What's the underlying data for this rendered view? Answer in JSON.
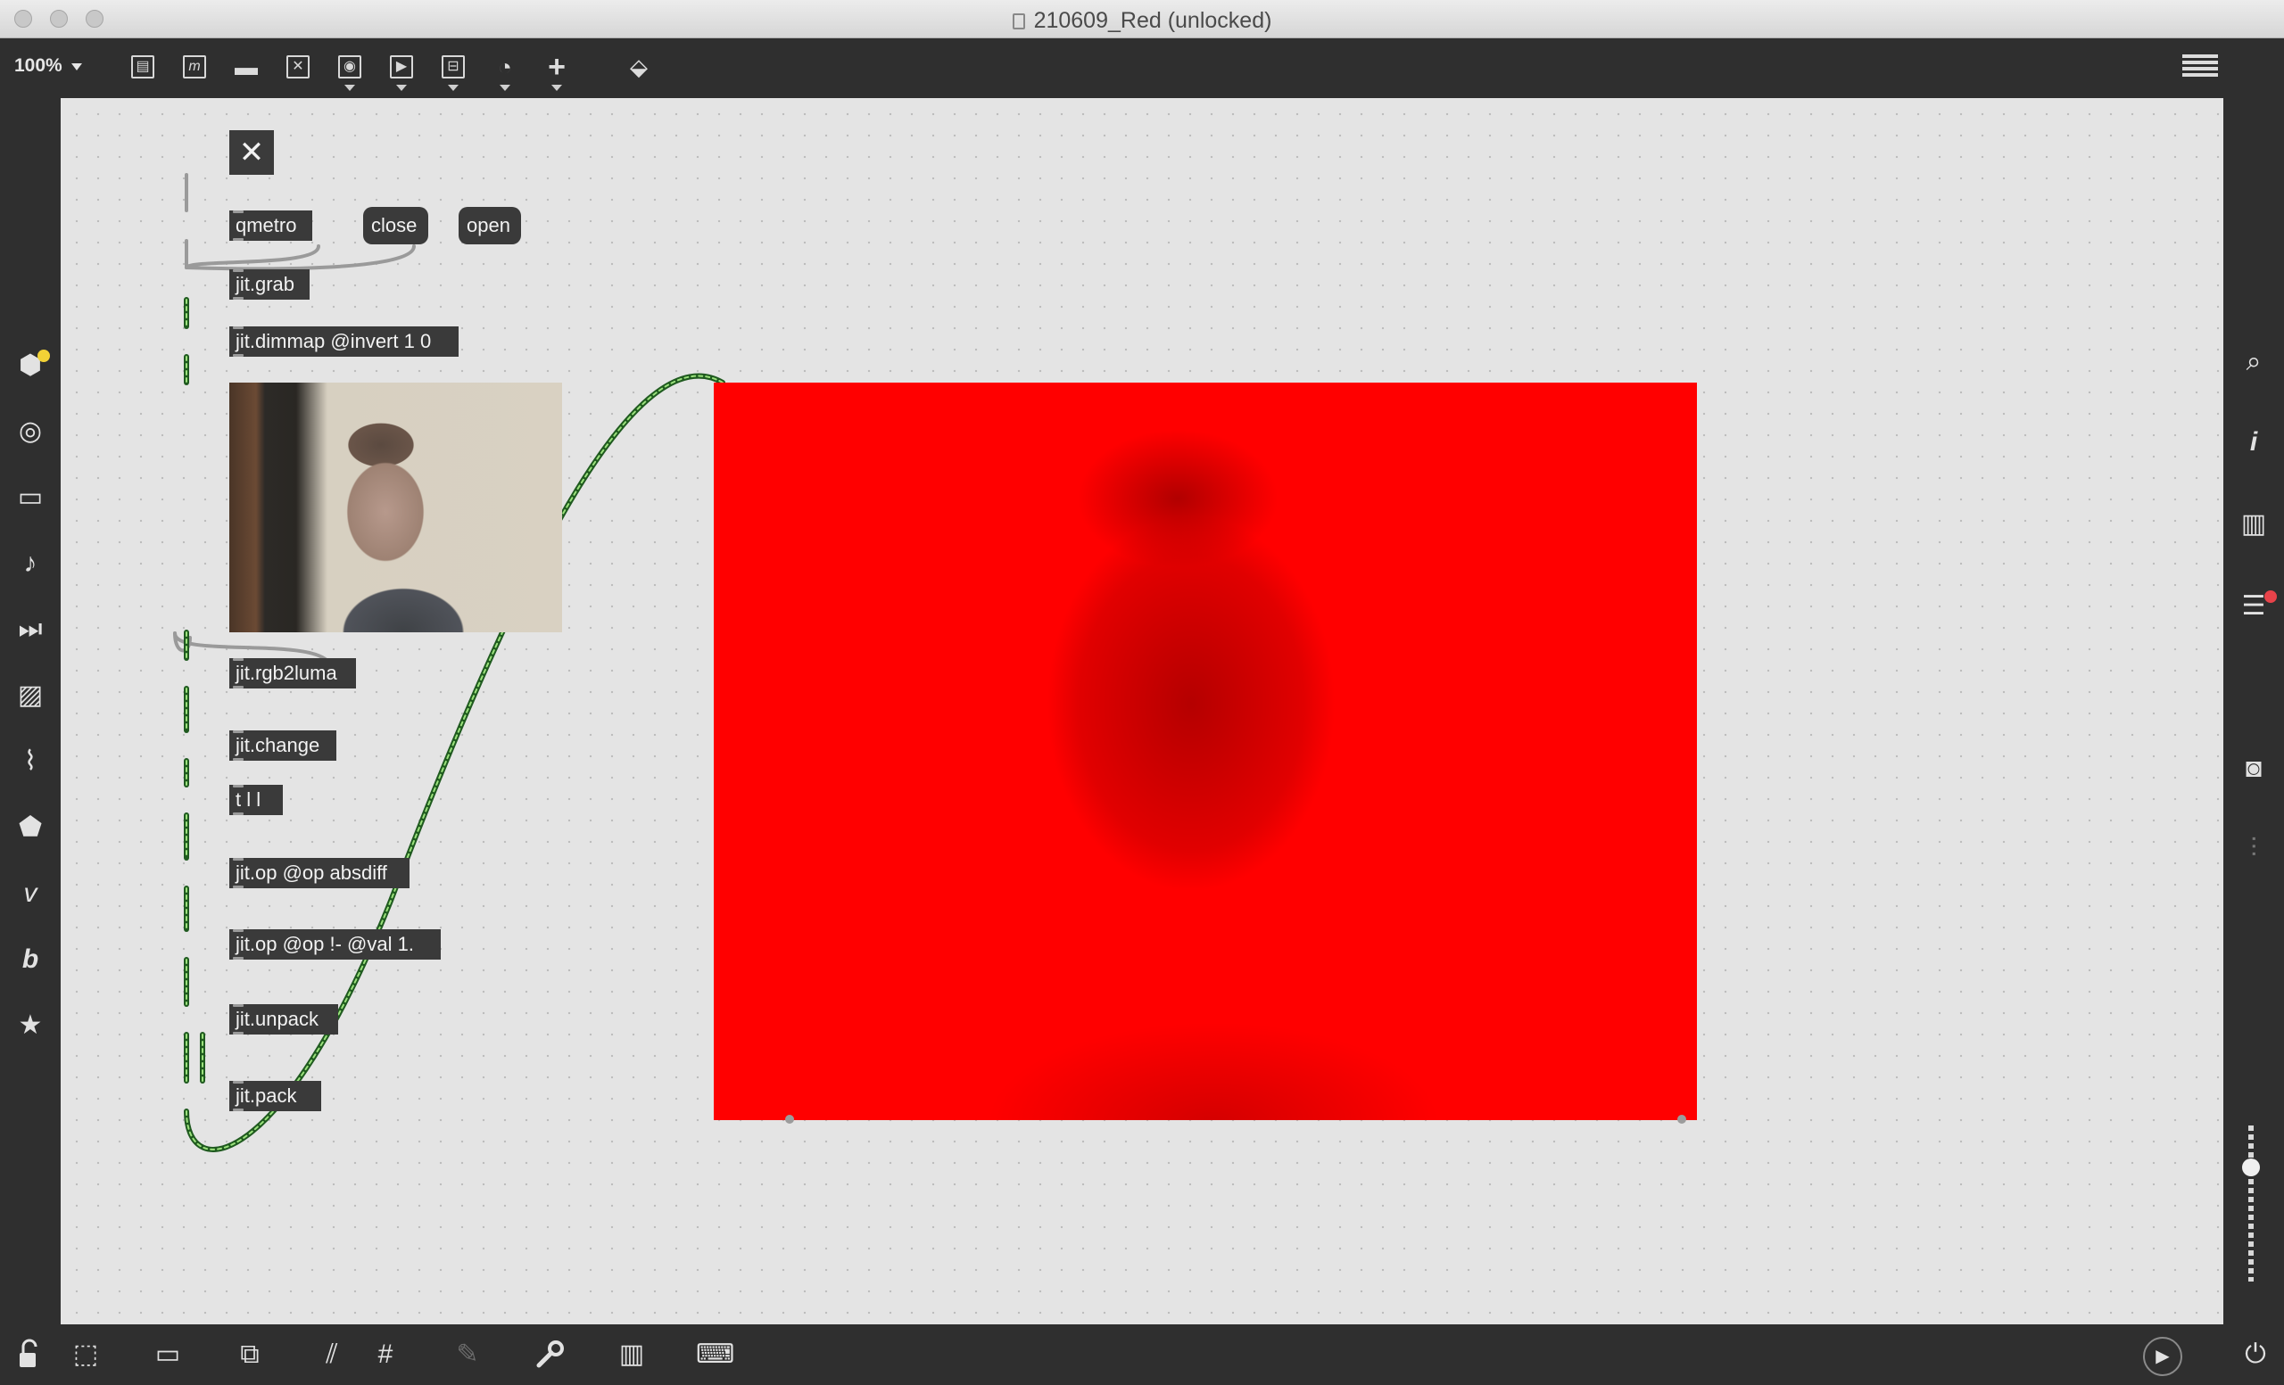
{
  "window": {
    "title": "210609_Red (unlocked)"
  },
  "toolbar": {
    "zoom": "100%",
    "tools": [
      {
        "name": "object-icon",
        "glyph": "▤"
      },
      {
        "name": "message-icon",
        "glyph": "m"
      },
      {
        "name": "comment-icon",
        "glyph": "▬"
      },
      {
        "name": "bang-icon",
        "glyph": "✕"
      },
      {
        "name": "toggle-icon",
        "glyph": "◉"
      },
      {
        "name": "number-icon",
        "glyph": "▶"
      },
      {
        "name": "slider-icon",
        "glyph": "⊟"
      },
      {
        "name": "dial-icon",
        "glyph": "◔"
      },
      {
        "name": "add-icon",
        "glyph": "+"
      },
      {
        "name": "paint-bucket-icon",
        "glyph": "⬙"
      }
    ]
  },
  "left_sidebar": [
    {
      "name": "packages-icon",
      "glyph": "⬢"
    },
    {
      "name": "target-icon",
      "glyph": "◎"
    },
    {
      "name": "media-icon",
      "glyph": "▭"
    },
    {
      "name": "music-note-icon",
      "glyph": "♪"
    },
    {
      "name": "step-forward-icon",
      "glyph": "⏭"
    },
    {
      "name": "image-icon",
      "glyph": "▨"
    },
    {
      "name": "paperclip-icon",
      "glyph": "⌇"
    },
    {
      "name": "plugin-icon",
      "glyph": "⬟"
    },
    {
      "name": "vimeo-icon",
      "glyph": "v"
    },
    {
      "name": "bold-b-icon",
      "glyph": "b"
    },
    {
      "name": "star-icon",
      "glyph": "★"
    }
  ],
  "right_sidebar": [
    {
      "name": "search-icon",
      "glyph": "⌕"
    },
    {
      "name": "info-icon",
      "glyph": "i"
    },
    {
      "name": "split-view-icon",
      "glyph": "▥"
    },
    {
      "name": "list-icon",
      "glyph": "☰"
    },
    {
      "name": "camera-icon",
      "glyph": "◙"
    },
    {
      "name": "mixer-icon",
      "glyph": "⫶"
    }
  ],
  "patch": {
    "toggle": "✕",
    "objects": {
      "qmetro": "qmetro",
      "close": "close",
      "open": "open",
      "jit_grab": "jit.grab",
      "jit_dimmap": "jit.dimmap @invert 1 0",
      "jit_rgb2luma": "jit.rgb2luma",
      "jit_change": "jit.change",
      "t_l_l": "t l l",
      "jit_op_absdiff": "jit.op @op absdiff",
      "jit_op_not": "jit.op @op !- @val 1.",
      "jit_unpack": "jit.unpack",
      "jit_pack": "jit.pack"
    }
  },
  "volume": {
    "level": 0.76
  },
  "bottom_bar": [
    {
      "name": "lock-icon",
      "glyph": "🔓"
    },
    {
      "name": "presentation-edit-icon",
      "glyph": "⬚"
    },
    {
      "name": "presentation-icon",
      "glyph": "▭"
    },
    {
      "name": "layers-icon",
      "glyph": "⧉"
    },
    {
      "name": "align-icon",
      "glyph": "⫽"
    },
    {
      "name": "grid-icon",
      "glyph": "#"
    },
    {
      "name": "snap-icon",
      "glyph": "✎"
    },
    {
      "name": "wrench-icon",
      "glyph": "🔧"
    },
    {
      "name": "piano-icon",
      "glyph": "▥"
    },
    {
      "name": "keyboard-icon",
      "glyph": "⌨"
    },
    {
      "name": "play-icon",
      "glyph": "▶"
    },
    {
      "name": "power-icon",
      "glyph": "⏻"
    }
  ]
}
